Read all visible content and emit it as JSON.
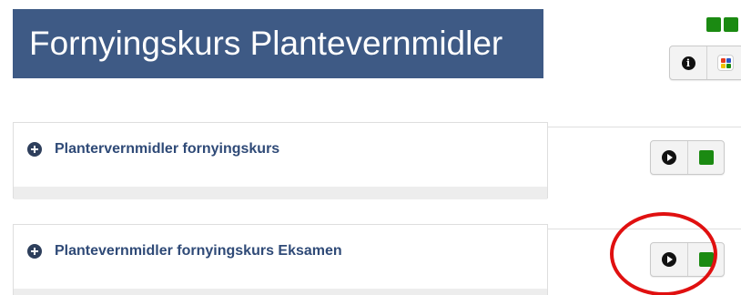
{
  "page": {
    "title": "Fornyingskurs Plantevernmidler"
  },
  "status_indicators": {
    "icon": "green-status-squares",
    "color": "#1b8a12"
  },
  "top_buttons": {
    "info_icon": "info-circle-icon",
    "colors_icon": "color-legend-icon",
    "colors": [
      "#e63b1e",
      "#2b55c7",
      "#f2c200",
      "#1b8a12"
    ]
  },
  "courses": [
    {
      "title": "Plantervernmidler fornyingskurs",
      "expand_icon": "plus-circle-icon",
      "play_icon": "play-circle-icon",
      "status_color": "#1b8a12"
    },
    {
      "title": "Plantevernmidler fornyingskurs Eksamen",
      "expand_icon": "plus-circle-icon",
      "play_icon": "play-circle-icon",
      "status_color": "#1b8a12"
    }
  ],
  "annotation": {
    "shape": "red-circle",
    "color": "#e01010"
  }
}
